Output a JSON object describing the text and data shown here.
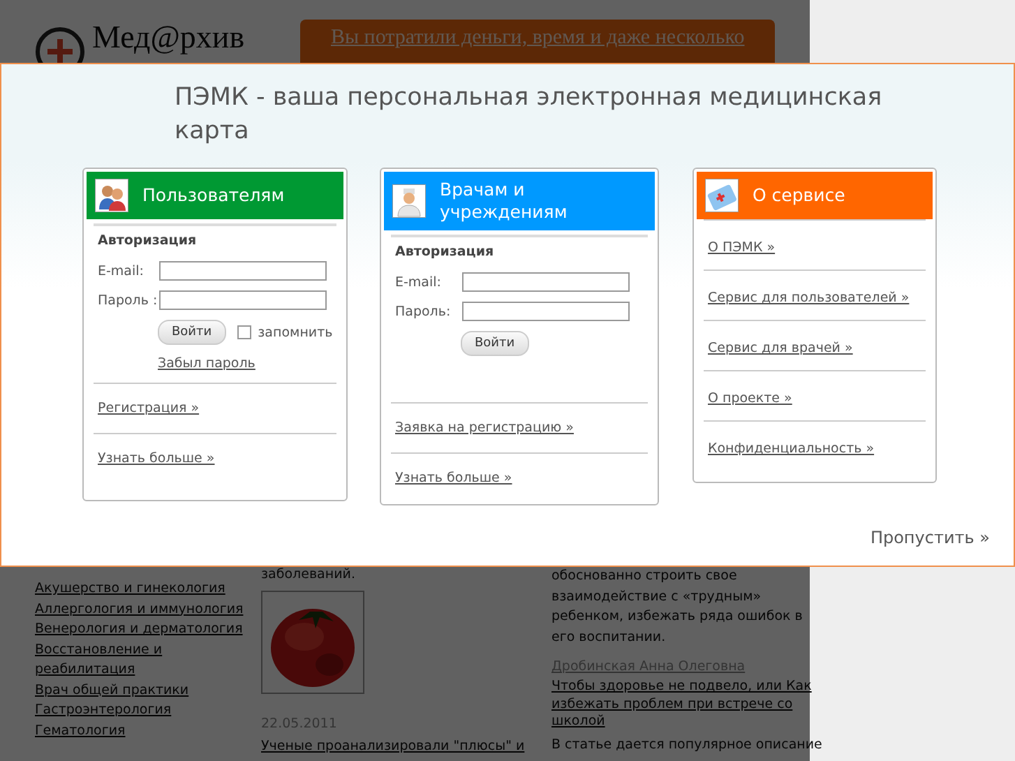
{
  "background_page": {
    "logo": "Мед@рхив",
    "banner": [
      "Вы потратили деньги, время и даже несколько"
    ],
    "left_text": "заболеваний.",
    "categories": [
      "Акушерство и гинекология",
      "Аллергология и иммунология",
      "Венерология и дерматология",
      "Восстановление и реабилитация",
      "Врач общей практики",
      "Гастроэнтерология",
      "Гематология"
    ],
    "news_date": "22.05.2011",
    "news_link": "Ученые проанализировали \"плюсы\" и",
    "article_text": "обоснованно строить свое взаимодействие с «трудным» ребенком, избежать ряда ошибок в его воспитании.",
    "author": "Дробинская Анна Олеговна",
    "article_link": "Чтобы здоровье не подвело, или Как избежать проблем при встрече со школой",
    "article_intro": "В статье дается популярное описание"
  },
  "modal": {
    "title": "ПЭМК - ваша персональная электронная медицинская карта",
    "panels": [
      {
        "kind": "login",
        "title": "Пользователям",
        "color": "#009933",
        "section": "Авторизация",
        "fields": [
          {
            "label": "E-mail:"
          },
          {
            "label": "Пароль :"
          }
        ],
        "button": "Войти",
        "remember": {
          "label": "запомнить",
          "checked": false
        },
        "forgot": "Забыл пароль",
        "links": [
          "Регистрация »",
          "Узнать больше »"
        ]
      },
      {
        "kind": "login",
        "title": "Врачам и учреждениям",
        "color": "#0099ff",
        "section": "Авторизация",
        "fields": [
          {
            "label": "E-mail:"
          },
          {
            "label": "Пароль:"
          }
        ],
        "button": "Войти",
        "links": [
          "Заявка на регистрацию »",
          "Узнать больше »"
        ]
      },
      {
        "kind": "links",
        "title": "О сервисе",
        "color": "#ff6600",
        "links": [
          "О ПЭМК »",
          "Сервис для пользователей »",
          "Сервис для врачей »",
          "О проекте »",
          "Конфиденциальность »"
        ]
      }
    ],
    "skip": "Пропустить »"
  }
}
